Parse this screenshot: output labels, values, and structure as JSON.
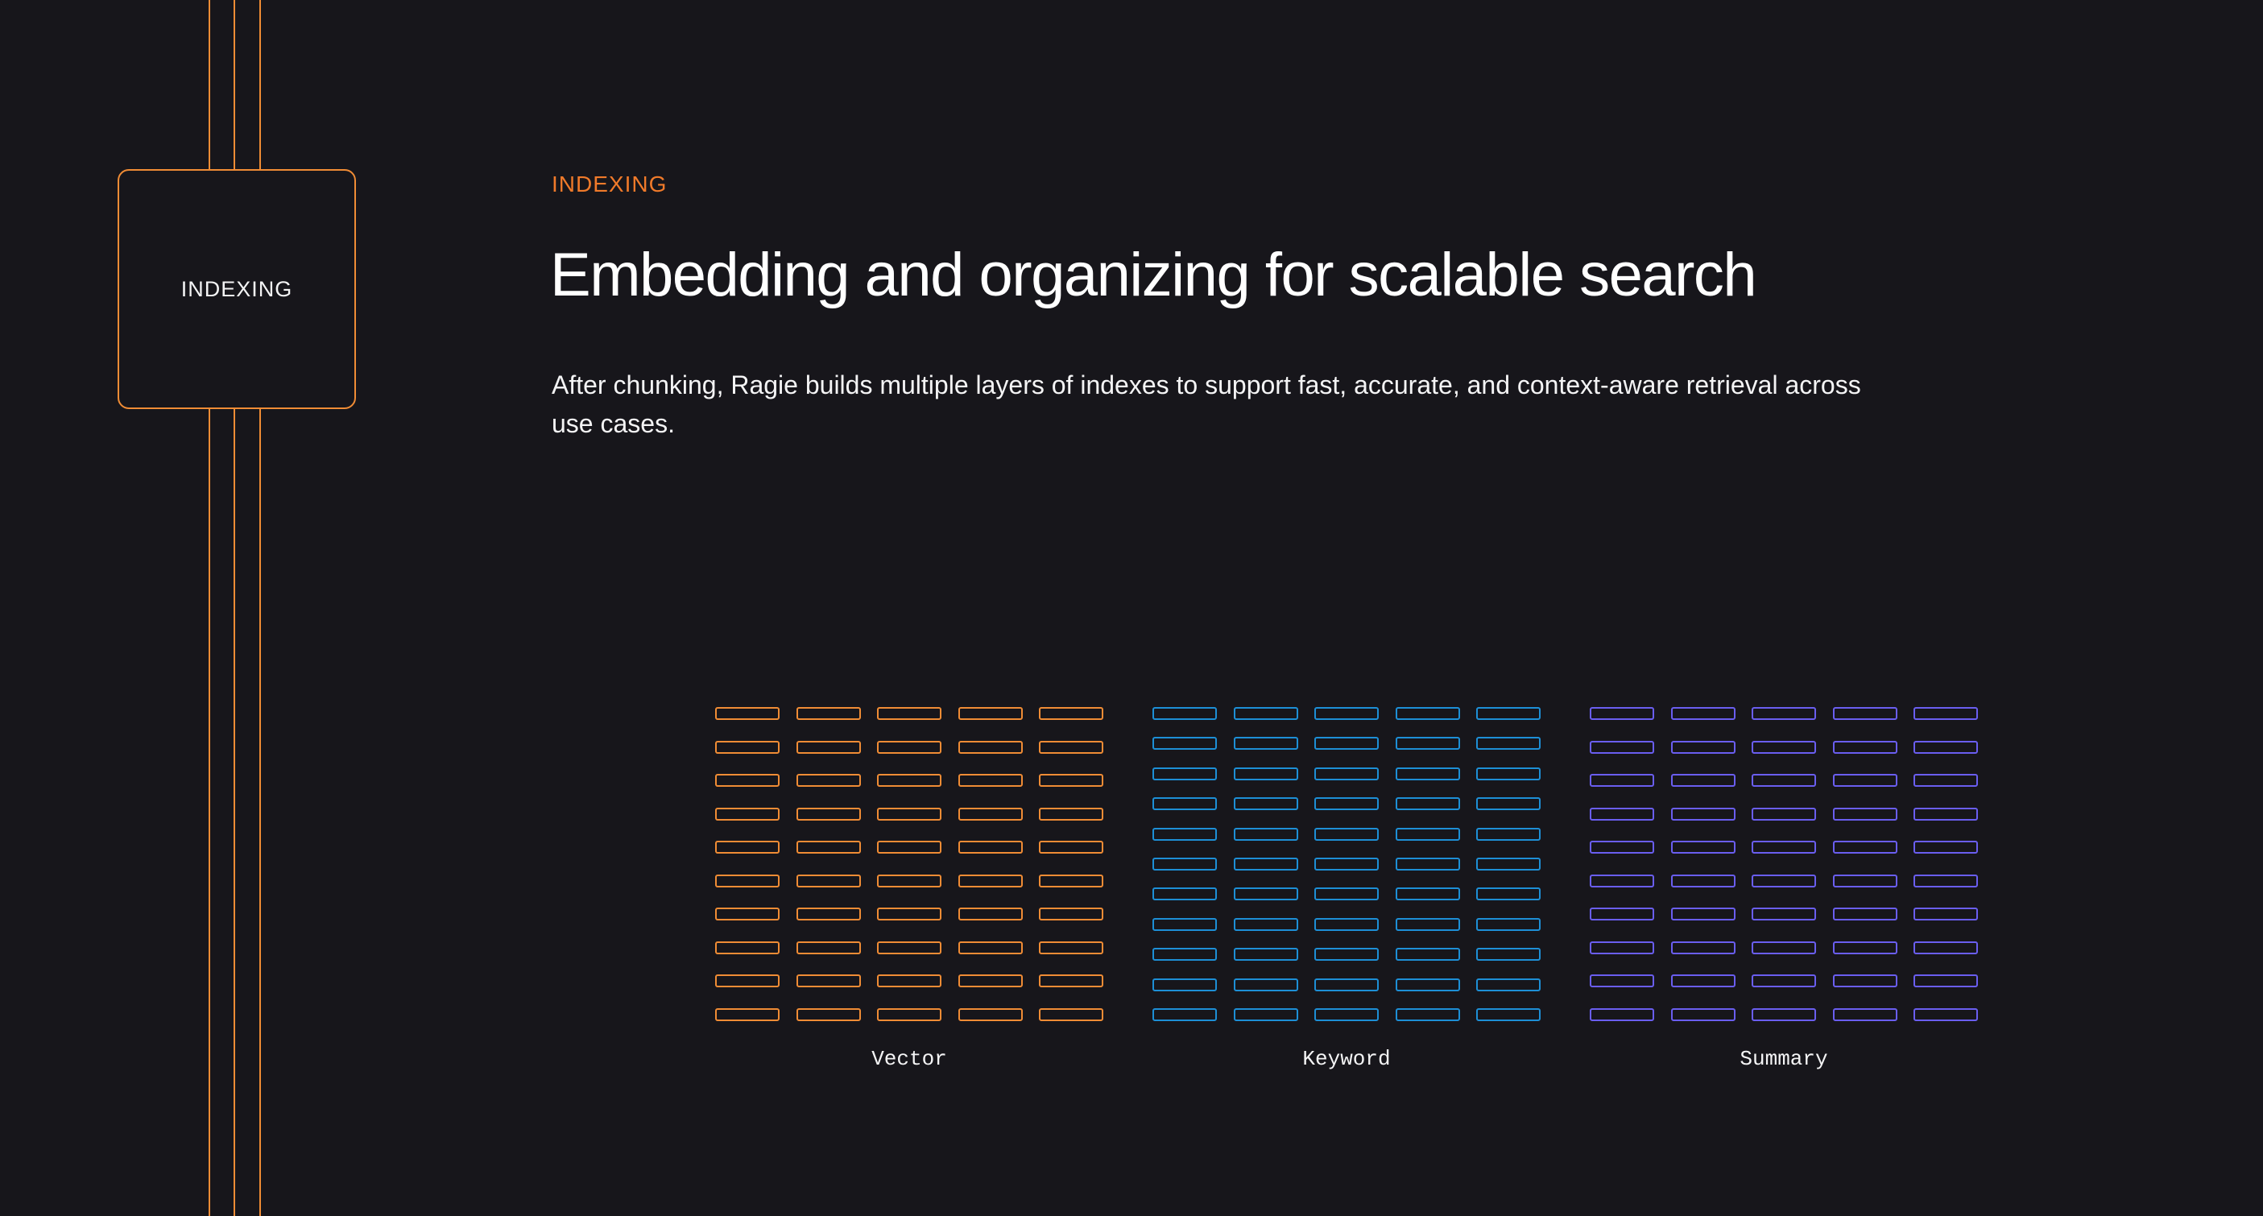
{
  "stage": {
    "label": "INDEXING"
  },
  "section": {
    "eyebrow": "INDEXING",
    "headline": "Embedding and organizing for scalable search",
    "description": "After chunking, Ragie builds multiple layers of indexes to support fast, accurate, and context-aware retrieval across use cases."
  },
  "indexes": [
    {
      "name": "Vector",
      "color": "#f08c35",
      "rows": 10,
      "columns": 5
    },
    {
      "name": "Keyword",
      "color": "#1d8fd6",
      "rows": 11,
      "columns": 5
    },
    {
      "name": "Summary",
      "color": "#6a5ef0",
      "rows": 10,
      "columns": 5
    }
  ],
  "colors": {
    "background": "#17161b",
    "accent": "#f08c35",
    "eyebrow": "#f07a2a"
  }
}
